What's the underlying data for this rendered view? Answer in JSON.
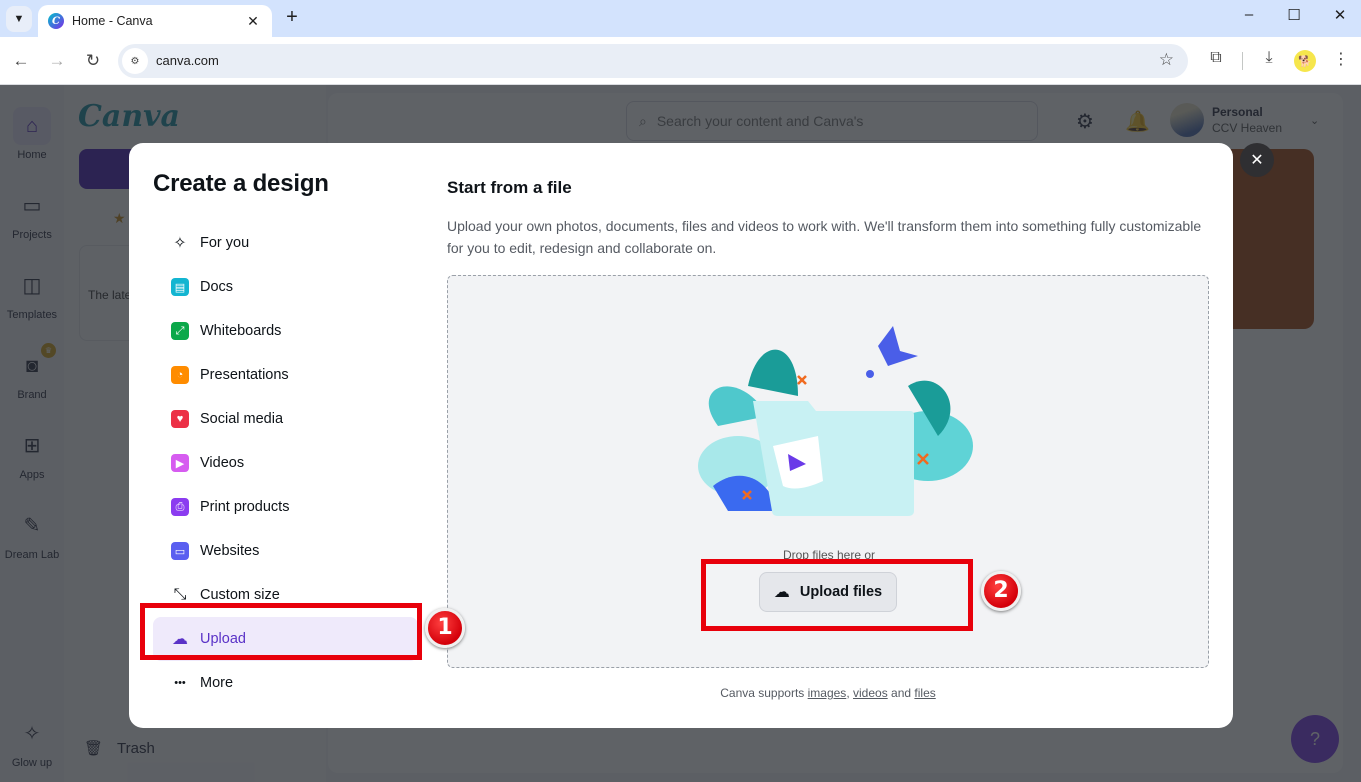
{
  "browser": {
    "tab_title": "Home - Canva",
    "tab_favicon": "C",
    "url": "canva.com",
    "icons": {
      "tab_menu": "chevron-down-icon",
      "new_tab": "+",
      "minimize": "–",
      "maximize": "☐",
      "close": "✕",
      "back": "←",
      "forward": "→",
      "reload": "↻",
      "bookmark": "☆",
      "extensions": "⧉",
      "downloads": "⤓",
      "menu": "⋮"
    }
  },
  "canva": {
    "logo": "Canva",
    "rail": [
      {
        "label": "Home",
        "icon": "⌂",
        "active": true
      },
      {
        "label": "Projects",
        "icon": "▭"
      },
      {
        "label": "Templates",
        "icon": "◫"
      },
      {
        "label": "Brand",
        "icon": "◙",
        "badge": "♛"
      },
      {
        "label": "Apps",
        "icon": "⊞"
      },
      {
        "label": "Dream Lab",
        "icon": "✎"
      },
      {
        "label": "Glow up",
        "icon": "✧"
      }
    ],
    "sidepanel": {
      "promo_star": "★",
      "news_preview": "The late",
      "trash_label": "Trash",
      "trash_icon": "🗑"
    },
    "header": {
      "search_placeholder": "Search your content and Canva's",
      "account_name": "Personal",
      "account_sub": "CCV Heaven"
    },
    "help_label": "?"
  },
  "modal": {
    "title": "Create a design",
    "close_label": "✕",
    "menu": [
      {
        "label": "For you",
        "icon": "✧",
        "color": ""
      },
      {
        "label": "Docs",
        "icon": "▤",
        "color": "#13b5d1"
      },
      {
        "label": "Whiteboards",
        "icon": "⤢",
        "color": "#0ba84a"
      },
      {
        "label": "Presentations",
        "icon": "◔",
        "color": "#ff8c00"
      },
      {
        "label": "Social media",
        "icon": "♥",
        "color": "#ec3046"
      },
      {
        "label": "Videos",
        "icon": "▶",
        "color": "#d65cf0"
      },
      {
        "label": "Print products",
        "icon": "⎙",
        "color": "#8b3cf0"
      },
      {
        "label": "Websites",
        "icon": "▭",
        "color": "#5a5ff0"
      },
      {
        "label": "Custom size",
        "icon": "⤡",
        "color": ""
      },
      {
        "label": "Upload",
        "icon": "☁",
        "color": "",
        "active": true
      },
      {
        "label": "More",
        "icon": "•••",
        "color": ""
      }
    ],
    "pane": {
      "title": "Start from a file",
      "description": "Upload your own photos, documents, files and videos to work with. We'll transform them into something fully customizable for you to edit, redesign and collaborate on.",
      "drop_text": "Drop files here or",
      "upload_button": "Upload files",
      "support_prefix": "Canva supports",
      "support_images": "images",
      "support_comma": ",",
      "support_videos": "videos",
      "support_and": "and",
      "support_files": "files"
    }
  },
  "annotations": [
    {
      "number": "1",
      "target": "Upload menu item"
    },
    {
      "number": "2",
      "target": "Upload files button"
    }
  ],
  "colors": {
    "accent": "#7d2ae8",
    "annotation_red": "#e8000b",
    "active_bg": "#efeafb"
  }
}
